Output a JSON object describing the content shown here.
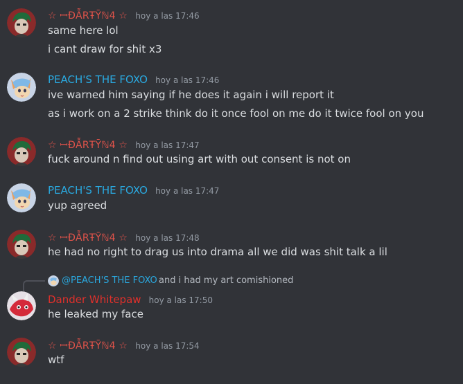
{
  "colors": {
    "background": "#313338",
    "dartyn_name": "#e0534a",
    "peach_name": "#2aa9e0",
    "dander_name": "#e0302b",
    "timestamp": "#949ba4",
    "message_text": "#dbdee1"
  },
  "users": {
    "dartyn": "☆ ꟷĐẪRŦȲℕ4 ☆",
    "peach": "PEACH'S THE FOXO",
    "dander": "Dander Whitepaw"
  },
  "groups": [
    {
      "author": "☆ ꟷĐẪRŦȲℕ4 ☆",
      "avatar_icon": "green-hair-character-avatar",
      "timestamp": "hoy a las 17:46",
      "messages": [
        "same here lol",
        "i cant draw for shit x3"
      ]
    },
    {
      "author": "PEACH'S THE FOXO",
      "avatar_icon": "fox-character-avatar",
      "timestamp": "hoy a las 17:46",
      "messages": [
        "ive warned him saying if he does it again i will report it",
        "as i work on a 2 strike think do it once fool on me do it twice fool on you"
      ]
    },
    {
      "author": "☆ ꟷĐẪRŦȲℕ4 ☆",
      "avatar_icon": "green-hair-character-avatar",
      "timestamp": "hoy a las 17:47",
      "messages": [
        "fuck around n find out using art with out consent is not on"
      ]
    },
    {
      "author": "PEACH'S THE FOXO",
      "avatar_icon": "fox-character-avatar",
      "timestamp": "hoy a las 17:47",
      "messages": [
        "yup agreed"
      ]
    },
    {
      "author": "☆ ꟷĐẪRŦȲℕ4 ☆",
      "avatar_icon": "green-hair-character-avatar",
      "timestamp": "hoy a las 17:48",
      "messages": [
        "he had no right to drag us into drama all we did was shit talk a lil"
      ]
    },
    {
      "author": "Dander Whitepaw",
      "avatar_icon": "red-dragon-character-avatar",
      "timestamp": "hoy a las 17:50",
      "reply_to": {
        "mention": "@PEACH'S THE FOXO",
        "text": "and i had my art comishioned"
      },
      "messages": [
        "he leaked my face"
      ]
    },
    {
      "author": "☆ ꟷĐẪRŦȲℕ4 ☆",
      "avatar_icon": "green-hair-character-avatar",
      "timestamp": "hoy a las 17:54",
      "messages": [
        "wtf"
      ]
    }
  ]
}
